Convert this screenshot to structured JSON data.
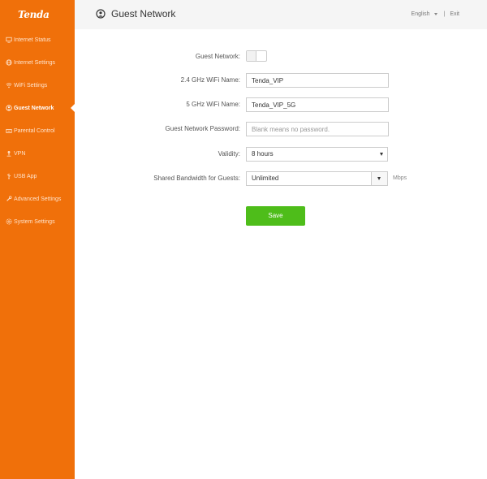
{
  "brand": {
    "logo_text": "Tenda"
  },
  "sidebar": {
    "items": [
      {
        "label": "Internet Status",
        "icon": "monitor-icon",
        "active": false
      },
      {
        "label": "Internet Settings",
        "icon": "globe-icon",
        "active": false
      },
      {
        "label": "WiFi Settings",
        "icon": "wifi-icon",
        "active": false
      },
      {
        "label": "Guest Network",
        "icon": "guest-network-icon",
        "active": true
      },
      {
        "label": "Parental Control",
        "icon": "parental-control-icon",
        "active": false
      },
      {
        "label": "VPN",
        "icon": "vpn-icon",
        "active": false
      },
      {
        "label": "USB App",
        "icon": "usb-icon",
        "active": false
      },
      {
        "label": "Advanced Settings",
        "icon": "wrench-icon",
        "active": false
      },
      {
        "label": "System Settings",
        "icon": "gear-icon",
        "active": false
      }
    ]
  },
  "header": {
    "title": "Guest Network",
    "icon": "guest-network-icon",
    "language": "English",
    "separator": "|",
    "exit_label": "Exit"
  },
  "form": {
    "guest_network_label": "Guest Network:",
    "guest_network_enabled": false,
    "ssid_24_label": "2.4 GHz WiFi Name:",
    "ssid_24_value": "Tenda_VIP",
    "ssid_5_label": "5 GHz WiFi Name:",
    "ssid_5_value": "Tenda_VIP_5G",
    "password_label": "Guest Network Password:",
    "password_placeholder": "Blank means no password.",
    "validity_label": "Validity:",
    "validity_value": "8 hours",
    "bandwidth_label": "Shared Bandwidth for Guests:",
    "bandwidth_value": "Unlimited",
    "bandwidth_unit": "Mbps",
    "save_label": "Save"
  },
  "colors": {
    "sidebar_bg": "#f0700a",
    "save_button": "#4ebd1a",
    "topbar_bg": "#f5f5f5"
  }
}
